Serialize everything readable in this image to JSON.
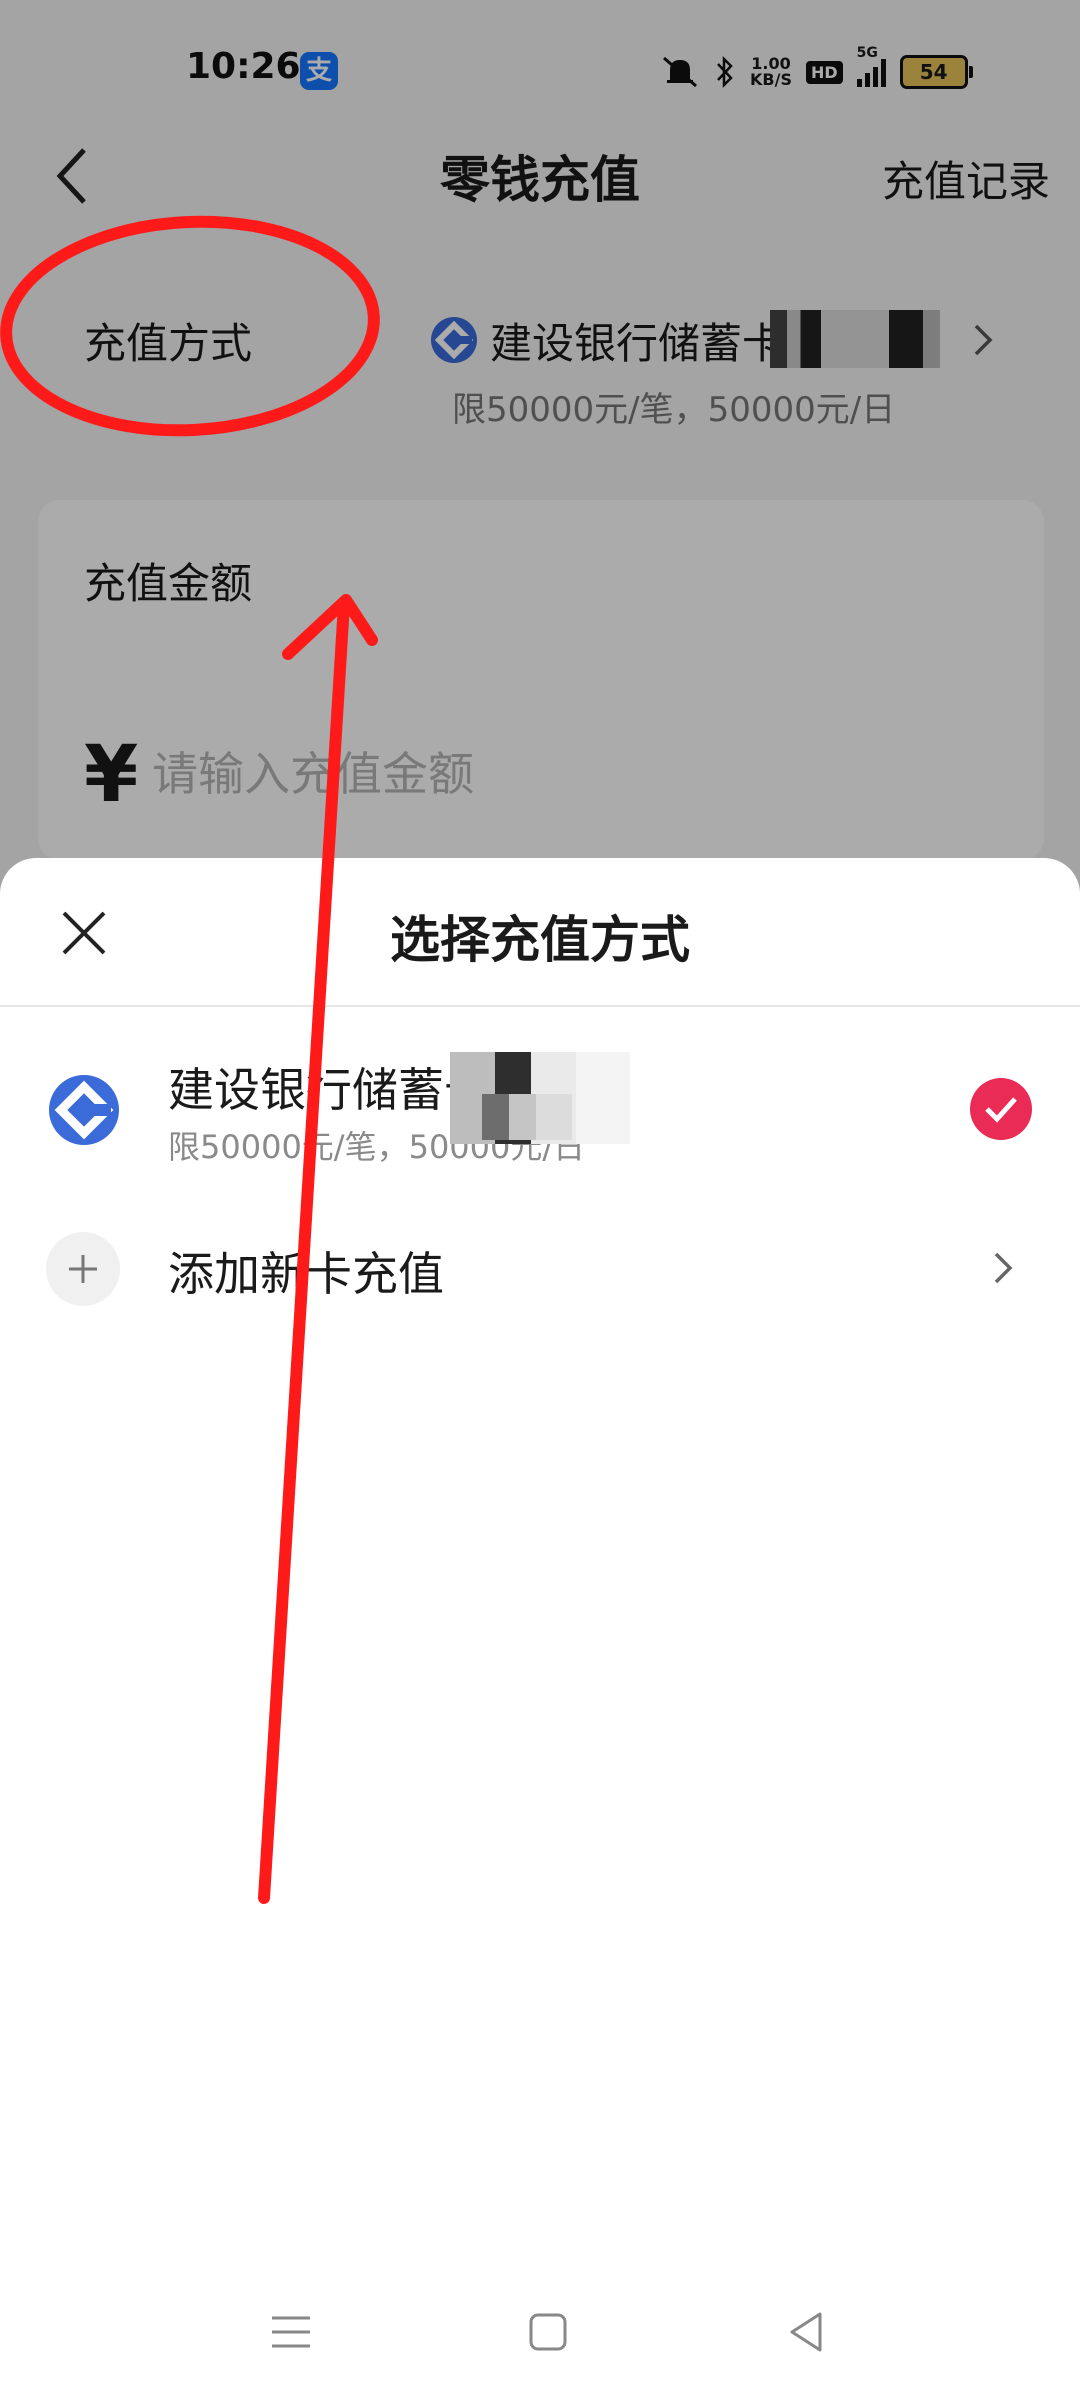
{
  "status_bar": {
    "time": "10:26",
    "app_badge": "支",
    "speed_value": "1.00",
    "speed_unit": "KB/S",
    "hd": "HD",
    "network": "5G",
    "battery": "54"
  },
  "header": {
    "title": "零钱充值",
    "right_link": "充值记录"
  },
  "payment_method": {
    "label": "充值方式",
    "bank_name": "建设银行储蓄卡",
    "limit": "限50000元/笔，50000元/日"
  },
  "amount": {
    "label": "充值金额",
    "currency_symbol": "¥",
    "placeholder": "请输入充值金额"
  },
  "sheet": {
    "title": "选择充值方式",
    "options": [
      {
        "bank_name": "建设银行储蓄卡",
        "limit": "限50000元/笔，50000元/日",
        "selected": true
      },
      {
        "label": "添加新卡充值"
      }
    ]
  },
  "colors": {
    "bank_blue": "#3a6bd8",
    "check_red": "#ea2b56",
    "annotation_red": "#ff1a1a"
  }
}
